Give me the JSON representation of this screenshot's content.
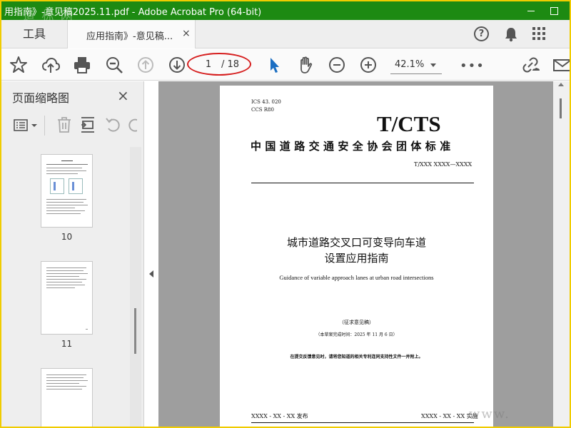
{
  "window": {
    "title": "用指南》-意见稿2025.11.pdf - Adobe Acrobat Pro (64-bit)",
    "watermark": "道 标 网"
  },
  "tabs": {
    "tools_label": "工具",
    "doc_label": "应用指南》-意见稿...",
    "close_glyph": "×"
  },
  "toolbar": {
    "page_current": "1",
    "page_total": "/ 18",
    "zoom": "42.1%",
    "more": "•••"
  },
  "panel": {
    "title": "页面缩略图",
    "close_glyph": "×",
    "thumbnails": [
      {
        "label": "10"
      },
      {
        "label": "11"
      }
    ]
  },
  "document": {
    "ics_code": "ICS  43. 020",
    "ccs_code": "CCS  R80",
    "standard_mark": "T/CTS",
    "org_name": "中国道路交通安全协会团体标准",
    "standard_number": "T/XXX XXXX—XXXX",
    "title_line1": "城市道路交叉口可变导向车道",
    "title_line2": "设置应用指南",
    "title_en": "Guidance of variable approach lanes at urban road intersections",
    "draft_label": "（征求意见稿）",
    "draft_date": "（本草案完成时间：2025 年 11 月 6 日）",
    "patent_note": "在提交反馈意见时，请将您知道的相关专利连同支持性文件一并附上。",
    "publish_label": "XXXX - XX - XX 发布",
    "implement_label": "XXXX - XX - XX 实施"
  },
  "watermark_bottom": "www."
}
